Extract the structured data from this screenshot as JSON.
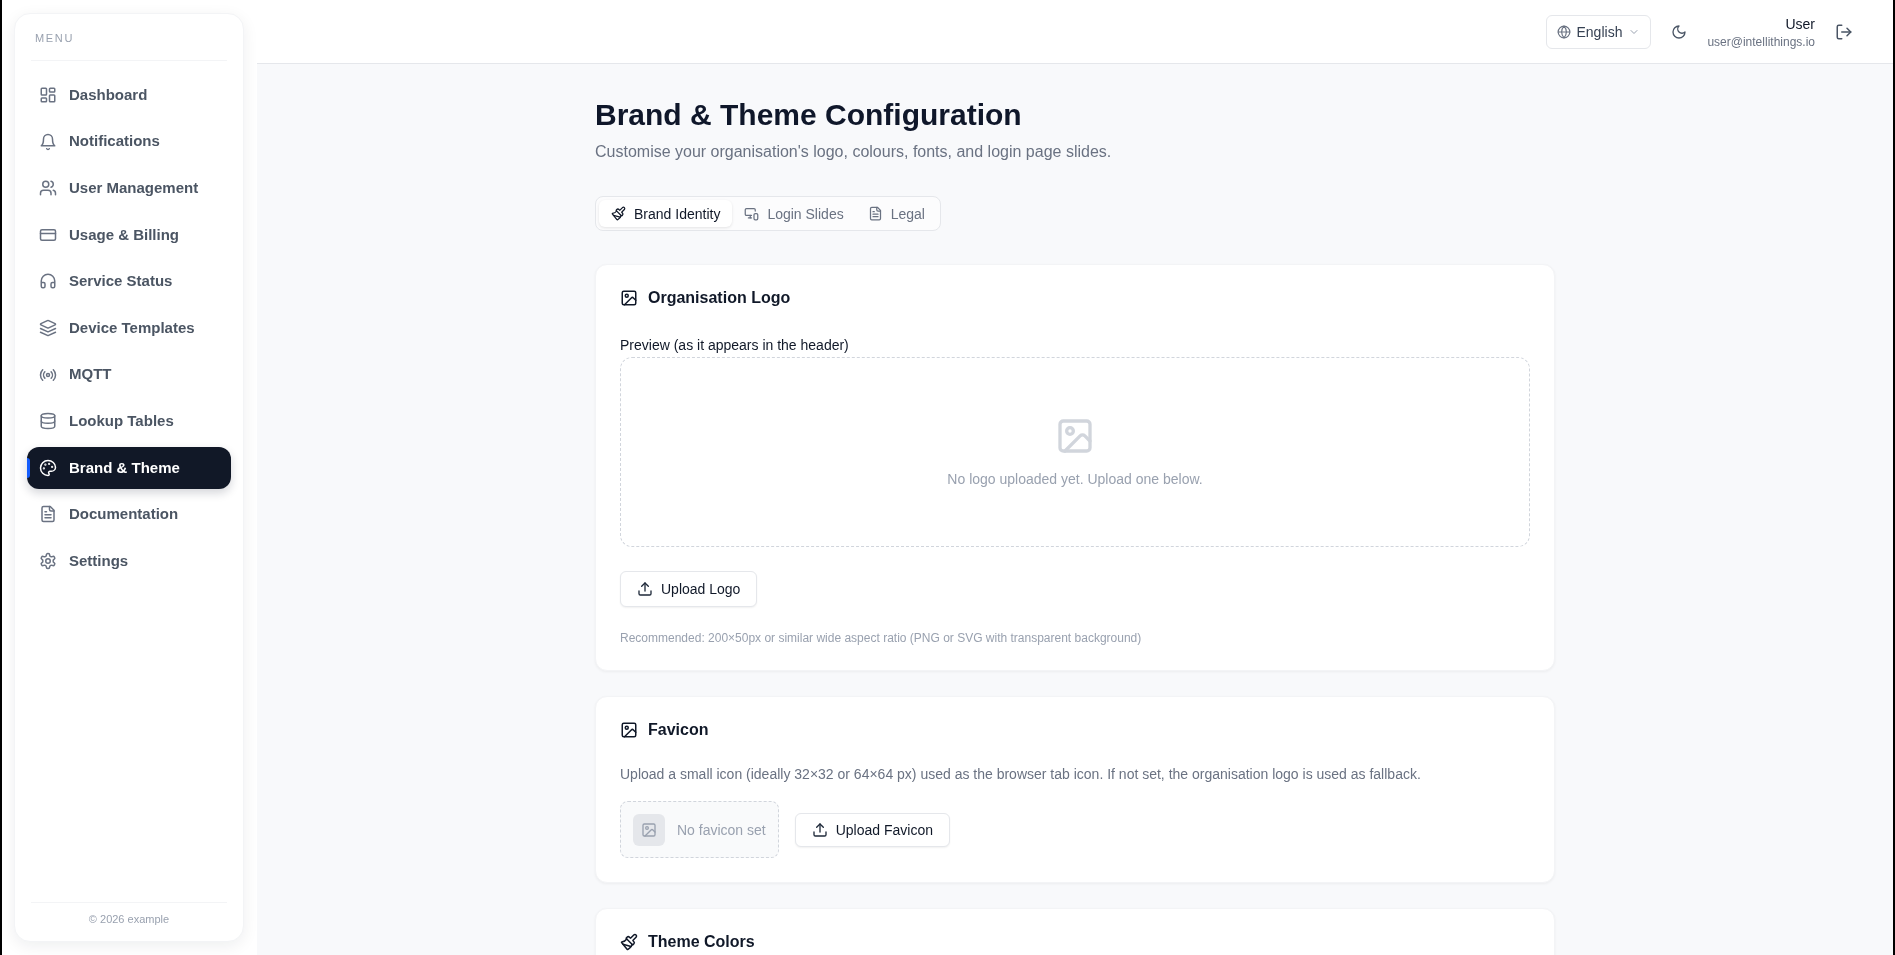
{
  "sidebar": {
    "heading": "MENU",
    "items": [
      {
        "label": "Dashboard",
        "selected": false
      },
      {
        "label": "Notifications",
        "selected": false
      },
      {
        "label": "User Management",
        "selected": false
      },
      {
        "label": "Usage & Billing",
        "selected": false
      },
      {
        "label": "Service Status",
        "selected": false
      },
      {
        "label": "Device Templates",
        "selected": false
      },
      {
        "label": "MQTT",
        "selected": false
      },
      {
        "label": "Lookup Tables",
        "selected": false
      },
      {
        "label": "Brand & Theme",
        "selected": true
      },
      {
        "label": "Documentation",
        "selected": false
      },
      {
        "label": "Settings",
        "selected": false
      }
    ],
    "footer": "© 2026 example"
  },
  "header": {
    "language": "English",
    "user_name": "User",
    "user_email": "user@intellithings.io"
  },
  "page": {
    "title": "Brand & Theme Configuration",
    "subtitle": "Customise your organisation's logo, colours, fonts, and login page slides."
  },
  "tabs": [
    {
      "label": "Brand Identity",
      "selected": true
    },
    {
      "label": "Login Slides",
      "selected": false
    },
    {
      "label": "Legal",
      "selected": false
    }
  ],
  "sections": [
    {
      "kind": "logo",
      "title": "Organisation Logo",
      "preview_label": "Preview (as it appears in the header)",
      "empty_text": "No logo uploaded yet. Upload one below.",
      "button": "Upload Logo",
      "hint": "Recommended: 200×50px or similar wide aspect ratio (PNG or SVG with transparent background)"
    },
    {
      "kind": "favicon",
      "title": "Favicon",
      "description": "Upload a small icon (ideally 32×32 or 64×64 px) used as the browser tab icon. If not set, the organisation logo is used as fallback.",
      "empty_text": "No favicon set",
      "button": "Upload Favicon"
    },
    {
      "kind": "colors",
      "title": "Theme Colors"
    }
  ]
}
